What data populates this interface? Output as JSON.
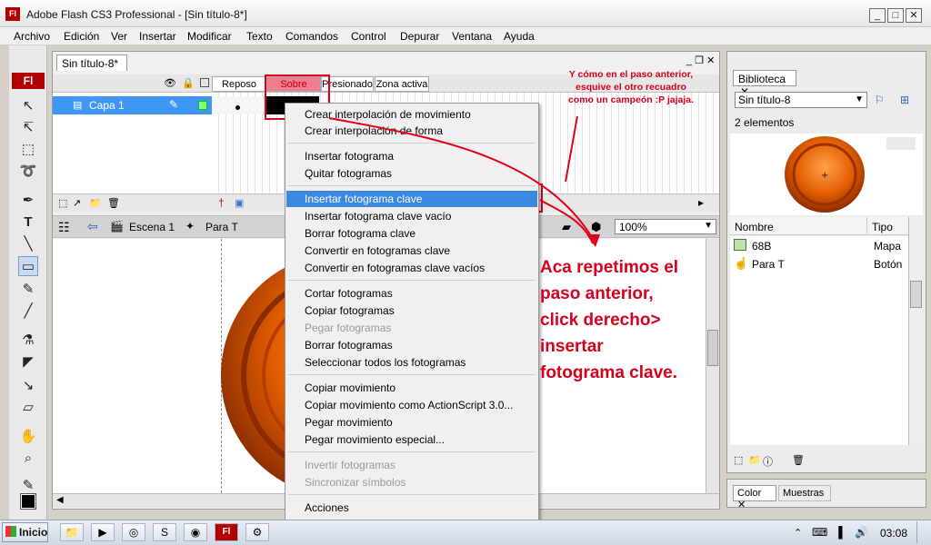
{
  "window": {
    "title": "Adobe Flash CS3 Professional - [Sin título-8*]",
    "app_icon": "Fl",
    "controls": [
      "_",
      "□",
      "✕"
    ]
  },
  "menubar": [
    "Archivo",
    "Edición",
    "Ver",
    "Insertar",
    "Modificar",
    "Texto",
    "Comandos",
    "Control",
    "Depurar",
    "Ventana",
    "Ayuda"
  ],
  "document": {
    "tab": "Sin título-8*",
    "frame_labels": [
      "Reposo",
      "Sobre",
      "Presionado",
      "Zona activa"
    ],
    "layer_name": "Capa 1",
    "breadcrumb_scene": "Escena 1",
    "breadcrumb_symbol": "Para T",
    "zoom": "100%"
  },
  "library": {
    "tab": "Biblioteca",
    "document_select": "Sin título-8",
    "count": "2 elementos",
    "col_name": "Nombre",
    "col_type": "Tipo",
    "items": [
      {
        "name": "68B",
        "type": "Mapa"
      },
      {
        "name": "Para T",
        "type": "Botón"
      }
    ]
  },
  "color_panel": {
    "tab_color": "Color",
    "tab_swatches": "Muestras"
  },
  "context_menu": {
    "items": [
      {
        "label": "Crear interpolación de movimiento",
        "disabled": false
      },
      {
        "label": "Crear interpolación de forma",
        "disabled": false
      },
      {
        "label": "Insertar fotograma",
        "disabled": false
      },
      {
        "label": "Quitar fotogramas",
        "disabled": false
      },
      {
        "label": "Insertar fotograma clave",
        "disabled": false,
        "highlighted": true
      },
      {
        "label": "Insertar fotograma clave vacío",
        "disabled": false
      },
      {
        "label": "Borrar fotograma clave",
        "disabled": false
      },
      {
        "label": "Convertir en fotogramas clave",
        "disabled": false
      },
      {
        "label": "Convertir en fotogramas clave vacíos",
        "disabled": false
      },
      {
        "label": "Cortar fotogramas",
        "disabled": false
      },
      {
        "label": "Copiar fotogramas",
        "disabled": false
      },
      {
        "label": "Pegar fotogramas",
        "disabled": true
      },
      {
        "label": "Borrar fotogramas",
        "disabled": false
      },
      {
        "label": "Seleccionar todos los fotogramas",
        "disabled": false
      },
      {
        "label": "Copiar movimiento",
        "disabled": false
      },
      {
        "label": "Copiar movimiento como ActionScript 3.0...",
        "disabled": false
      },
      {
        "label": "Pegar movimiento",
        "disabled": false
      },
      {
        "label": "Pegar movimiento especial...",
        "disabled": false
      },
      {
        "label": "Invertir fotogramas",
        "disabled": true
      },
      {
        "label": "Sincronizar símbolos",
        "disabled": true
      },
      {
        "label": "Acciones",
        "disabled": false
      }
    ]
  },
  "annotations": {
    "top_note": [
      "Y cómo en el paso anterior,",
      "esquive el otro recuadro",
      "como un campeón :P jajaja."
    ],
    "main_note": [
      "Aca repetimos el",
      "paso anterior,",
      "click derecho>",
      "insertar",
      "fotograma clave."
    ]
  },
  "taskbar": {
    "start": "Inicio",
    "clock": "03:08"
  },
  "colors": {
    "annotation_red": "#e0001b",
    "highlight_blue": "#3a88e0",
    "orb_orange": "#e35d00"
  }
}
